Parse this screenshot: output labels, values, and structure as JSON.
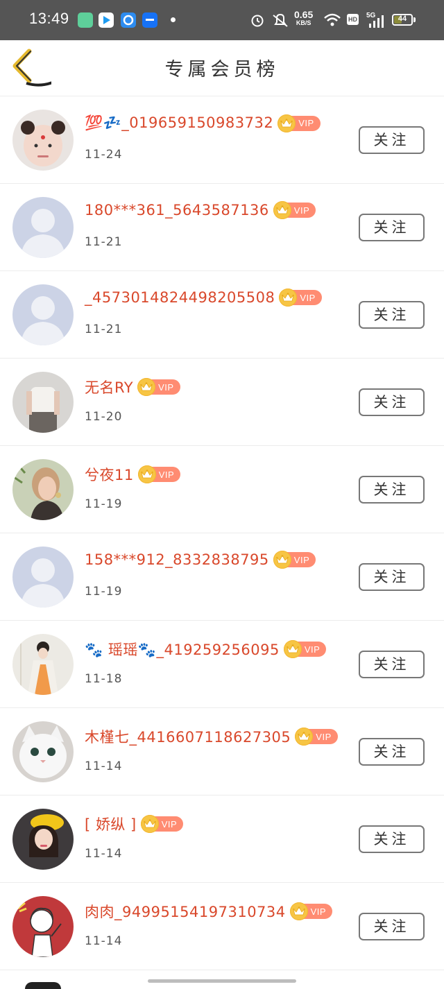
{
  "status_bar": {
    "time": "13:49",
    "speed_value": "0.65",
    "speed_unit": "KB/S",
    "hd": "HD",
    "network": "5G",
    "battery": "44",
    "battery_level": 0.44
  },
  "header": {
    "title": "专属会员榜",
    "back_icon": "chevron-left-icon"
  },
  "badge_label": "VIP",
  "follow_label": "关注",
  "members": [
    {
      "name": "💯💤_019659150983732",
      "date": "11-24",
      "avatar": "baby-photo"
    },
    {
      "name": "180***361_5643587136",
      "date": "11-21",
      "avatar": "default"
    },
    {
      "name": "_4573014824498205508",
      "date": "11-21",
      "avatar": "default"
    },
    {
      "name": "无名RY",
      "date": "11-20",
      "avatar": "girl-white-top"
    },
    {
      "name": "兮夜11",
      "date": "11-19",
      "avatar": "blonde-girl"
    },
    {
      "name": "158***912_8332838795",
      "date": "11-19",
      "avatar": "default"
    },
    {
      "name": "🐾 瑶瑶🐾_419259256095",
      "date": "11-18",
      "avatar": "costume-girl"
    },
    {
      "name": "木槿七_4416607118627305",
      "date": "11-14",
      "avatar": "white-cat"
    },
    {
      "name": "[ 娇纵 ]",
      "date": "11-14",
      "avatar": "yellow-hat-girl"
    },
    {
      "name": "肉肉_94995154197310734",
      "date": "11-14",
      "avatar": "cartoon-girl-red"
    }
  ],
  "colors": {
    "name_color": "#d9482b",
    "vip_badge": "#ff8c72",
    "crown": "#f7c544",
    "status_bar": "#555555"
  }
}
